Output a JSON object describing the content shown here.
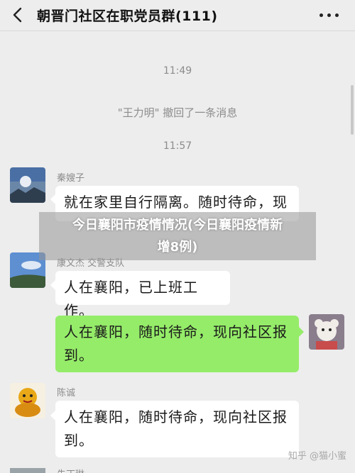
{
  "header": {
    "title": "朝晋门社区在职党员群(111)",
    "back_icon": "chevron-left-icon",
    "more_icon": "more-dots-icon"
  },
  "messages": {
    "time1": "11:49",
    "system_notice": "\"王力明\" 撤回了一条消息",
    "time2": "11:57",
    "msg1": {
      "sender": "秦嫂子",
      "line1": "就在家里自行隔离。随时待命，现",
      "avatar_icon": "landscape-avatar"
    },
    "msg2": {
      "sender": "康文杰  交警支队",
      "text": "人在襄阳，已上班工作。",
      "avatar_icon": "sky-avatar"
    },
    "msg3": {
      "line1": "人在襄阳，随时待命，现向社区报",
      "line2": "到。",
      "avatar_icon": "plush-toy-avatar"
    },
    "msg4": {
      "sender": "陈诚",
      "line1": "人在襄阳，随时待命，现向社区报",
      "line2": "到。",
      "avatar_icon": "golden-figure-avatar"
    },
    "msg5": {
      "sender": "朱丁琳"
    }
  },
  "overlay": {
    "line1": "今日襄阳市疫情情况(今日襄阳疫情新",
    "line2": "增8例)"
  },
  "watermark": "知乎 @猫小蜜",
  "colors": {
    "background": "#ededed",
    "own_bubble": "#95ec69",
    "other_bubble": "#ffffff",
    "meta_text": "#8c8c8c"
  }
}
